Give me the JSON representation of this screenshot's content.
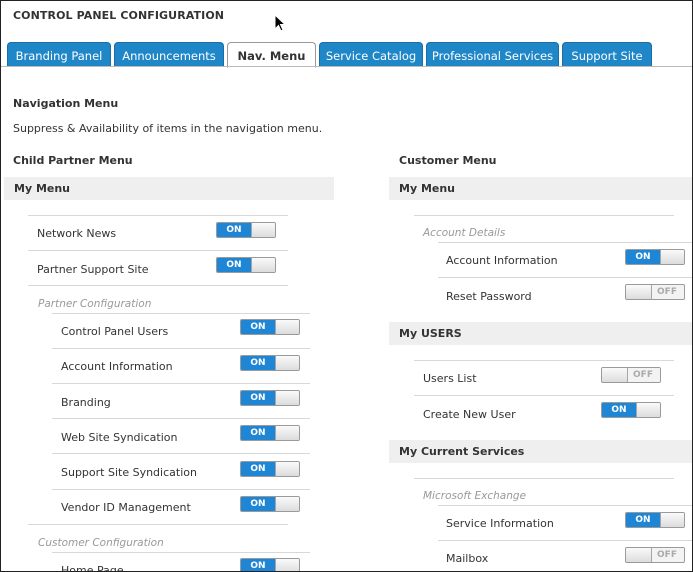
{
  "page": {
    "title": "CONTROL PANEL CONFIGURATION"
  },
  "tabs": [
    {
      "label": "Branding Panel"
    },
    {
      "label": "Announcements"
    },
    {
      "label": "Nav. Menu",
      "active": true
    },
    {
      "label": "Service Catalog"
    },
    {
      "label": "Professional Services"
    },
    {
      "label": "Support Site"
    }
  ],
  "nav": {
    "heading": "Navigation Menu",
    "description": "Suppress & Availability of items in the navigation menu."
  },
  "child_partner": {
    "heading": "Child Partner Menu",
    "my_menu": "My Menu",
    "items": [
      {
        "label": "Network News",
        "state": "ON"
      },
      {
        "label": "Partner Support Site",
        "state": "ON"
      }
    ],
    "partner_config": {
      "label": "Partner Configuration",
      "items": [
        {
          "label": "Control Panel Users",
          "state": "ON"
        },
        {
          "label": "Account Information",
          "state": "ON"
        },
        {
          "label": "Branding",
          "state": "ON"
        },
        {
          "label": "Web Site Syndication",
          "state": "ON"
        },
        {
          "label": "Support Site Syndication",
          "state": "ON"
        },
        {
          "label": "Vendor ID Management",
          "state": "ON"
        }
      ]
    },
    "customer_config": {
      "label": "Customer Configuration",
      "items": [
        {
          "label": "Home Page",
          "state": "ON"
        }
      ]
    }
  },
  "customer": {
    "heading": "Customer Menu",
    "my_menu": "My Menu",
    "account_details": {
      "label": "Account Details",
      "items": [
        {
          "label": "Account Information",
          "state": "ON"
        },
        {
          "label": "Reset Password",
          "state": "OFF"
        }
      ]
    },
    "my_users": {
      "heading": "My USERS",
      "items": [
        {
          "label": "Users List",
          "state": "OFF"
        },
        {
          "label": "Create New User",
          "state": "ON"
        }
      ]
    },
    "current_services": {
      "heading": "My Current Services",
      "exchange": {
        "label": "Microsoft Exchange",
        "items": [
          {
            "label": "Service Information",
            "state": "ON"
          },
          {
            "label": "Mailbox",
            "state": "OFF"
          }
        ]
      }
    }
  },
  "colors": {
    "tab_blue": "#1f86c8",
    "toggle_on": "#1f86d6",
    "band_bg": "#efefef"
  }
}
